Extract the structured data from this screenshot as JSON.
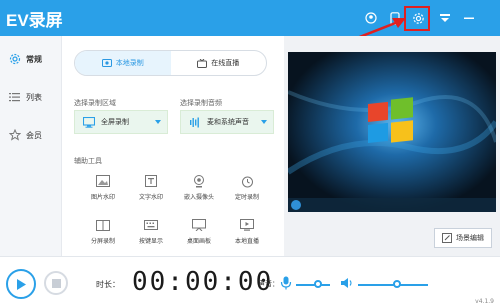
{
  "app": {
    "title": "EV录屏",
    "version": "v4.1.9"
  },
  "colors": {
    "brand": "#2aa0e8",
    "highlight": "#e02020"
  },
  "titlebar_icons": [
    "user-icon",
    "phone-icon",
    "settings-icon",
    "skin-icon",
    "minimize-icon"
  ],
  "sidebar": {
    "items": [
      {
        "label": "常规",
        "icon": "settings-gear-icon"
      },
      {
        "label": "列表",
        "icon": "list-icon"
      },
      {
        "label": "会员",
        "icon": "star-icon"
      }
    ]
  },
  "tabs": [
    {
      "label": "本地录制",
      "icon": "record-icon"
    },
    {
      "label": "在线直播",
      "icon": "live-icon"
    }
  ],
  "record_area": {
    "label": "选择录制区域",
    "value": "全屏录制"
  },
  "record_audio": {
    "label": "选择录制音频",
    "value": "麦和系统声音"
  },
  "tools": {
    "label": "辅助工具",
    "items": [
      {
        "label": "图片水印",
        "icon": "image-icon"
      },
      {
        "label": "文字水印",
        "icon": "text-icon"
      },
      {
        "label": "嵌入摄像头",
        "icon": "camera-icon"
      },
      {
        "label": "定时录制",
        "icon": "alarm-icon"
      },
      {
        "label": "分屏录制",
        "icon": "split-screen-icon"
      },
      {
        "label": "按键显示",
        "icon": "keyboard-icon"
      },
      {
        "label": "桌面画板",
        "icon": "whiteboard-icon"
      },
      {
        "label": "本地直播",
        "icon": "local-live-icon"
      }
    ]
  },
  "preview": {
    "scene_button": "场景编辑"
  },
  "bottom": {
    "duration_label": "时长：",
    "timer": "00:00:00",
    "sound_label": "声音：",
    "mic_level": 0.65,
    "speaker_level": 0.55
  }
}
